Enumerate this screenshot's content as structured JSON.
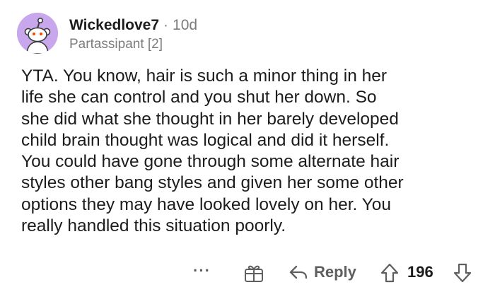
{
  "comment": {
    "author": "Wickedlove7",
    "separator": "·",
    "age": "10d",
    "flair": "Partassipant [2]",
    "body": "YTA.  You know, hair is such a minor thing in her\nlife she can control and you shut her down. So\nshe did what she thought in her barely developed\nchild brain thought was logical and did it herself.\nYou could have gone through some alternate hair\nstyles other bang styles and given her some other\noptions they may have looked lovely on her. You\nreally handled this situation poorly."
  },
  "actions": {
    "more_label": "···",
    "reply_label": "Reply",
    "score": "196"
  },
  "icons": {
    "avatar": "reddit-snoo-avatar",
    "award": "award-gift-icon",
    "reply": "reply-arrow-icon",
    "upvote": "upvote-arrow-icon",
    "downvote": "downvote-arrow-icon"
  },
  "colors": {
    "avatar_bg": "#c9a7ec",
    "text": "#1c1c1c",
    "meta": "#7c7c7c",
    "action": "#5f5f5f"
  }
}
